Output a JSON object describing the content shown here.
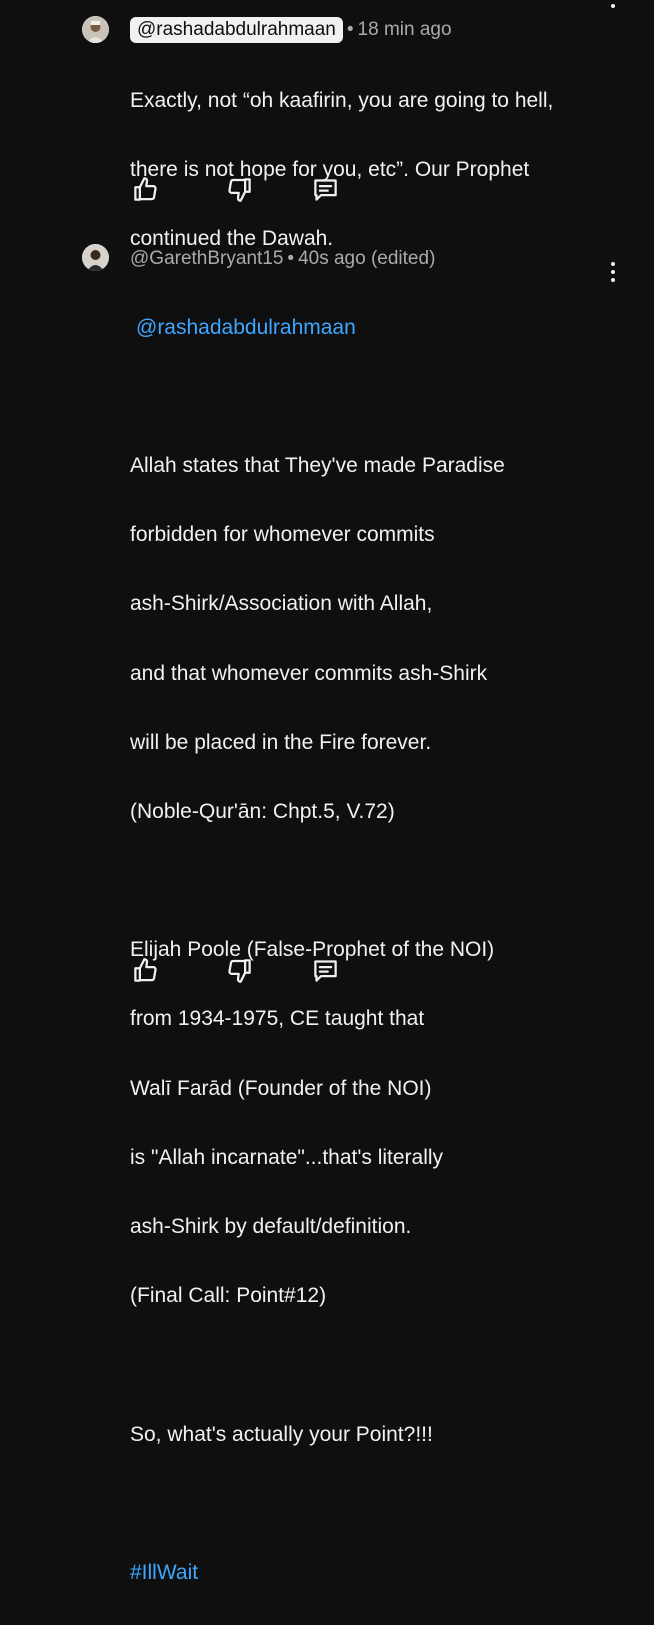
{
  "comments": [
    {
      "handle": "@rashadabdulrahmaan",
      "time": "18 min ago",
      "lines": [
        "Exactly, not “oh kaafirin, you are going to hell,",
        "there is not hope for you, etc”. Our Prophet",
        "continued the Dawah."
      ],
      "actions": {
        "like": "like-icon",
        "dislike": "dislike-icon",
        "reply": "reply-icon"
      }
    },
    {
      "handle": "@GarethBryant15",
      "time": "40s ago (edited)",
      "mention": "@rashadabdulrahmaan",
      "paragraph1": [
        "Allah states that They've made Paradise",
        "forbidden for whomever commits",
        "ash-Shirk/Association with Allah,",
        "and that whomever commits ash-Shirk",
        "will be placed in the Fire forever.",
        "(Noble-Qur'ān: Chpt.5, V.72)"
      ],
      "paragraph2": [
        "Elijah Poole (False-Prophet of the NOI)",
        "from 1934-1975, CE taught that",
        "Walī Farād (Founder of the NOI)",
        "is \"Allah incarnate\"...that's literally",
        "ash-Shirk by default/definition.",
        "(Final Call: Point#12)"
      ],
      "paragraph3": "So, what's actually your Point?!!!",
      "hashtag": "#IllWait"
    }
  ],
  "colors": {
    "background": "#0f0f0f",
    "text": "#f1f1f1",
    "meta": "#aaaaaa",
    "link": "#3ea6ff"
  }
}
